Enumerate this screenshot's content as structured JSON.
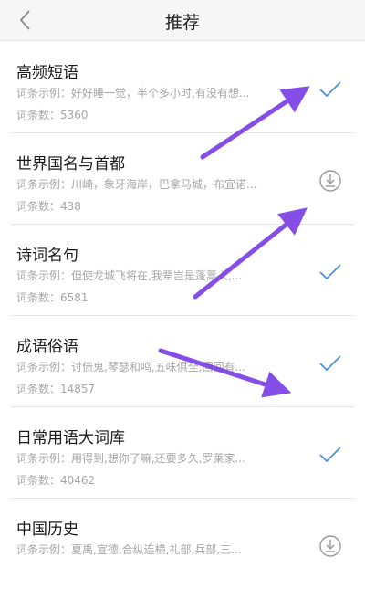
{
  "header": {
    "title": "推荐",
    "back_icon": "chevron-left-icon"
  },
  "items": [
    {
      "name": "高频短语",
      "example": "词条示例：好好睡一觉，半个多小时,有没有想...",
      "count": "词条数：5360",
      "status": "added"
    },
    {
      "name": "世界国名与首都",
      "example": "词条示例：川崎，象牙海岸，巴拿马城，布宜诺...",
      "count": "词条数：438",
      "status": "download"
    },
    {
      "name": "诗词名句",
      "example": "词条示例：但使龙城飞将在,我辈岂是蓬蒿人,...",
      "count": "词条数：6581",
      "status": "added"
    },
    {
      "name": "成语俗语",
      "example": "词条示例：讨债鬼,琴瑟和鸣,五味俱全,回回有...",
      "count": "词条数：14857",
      "status": "added"
    },
    {
      "name": "日常用语大词库",
      "example": "词条示例：用得到,想你了嘛,还要多久,罗莱家...",
      "count": "词条数：40462",
      "status": "added"
    },
    {
      "name": "中国历史",
      "example": "词条示例：夏禹,宣德,合纵连横,礼部,兵部,三...",
      "count": "",
      "status": "download"
    }
  ],
  "colors": {
    "check": "#4a90e2",
    "download": "#9a9a9a",
    "annotation_arrow": "#7b3fe4"
  }
}
